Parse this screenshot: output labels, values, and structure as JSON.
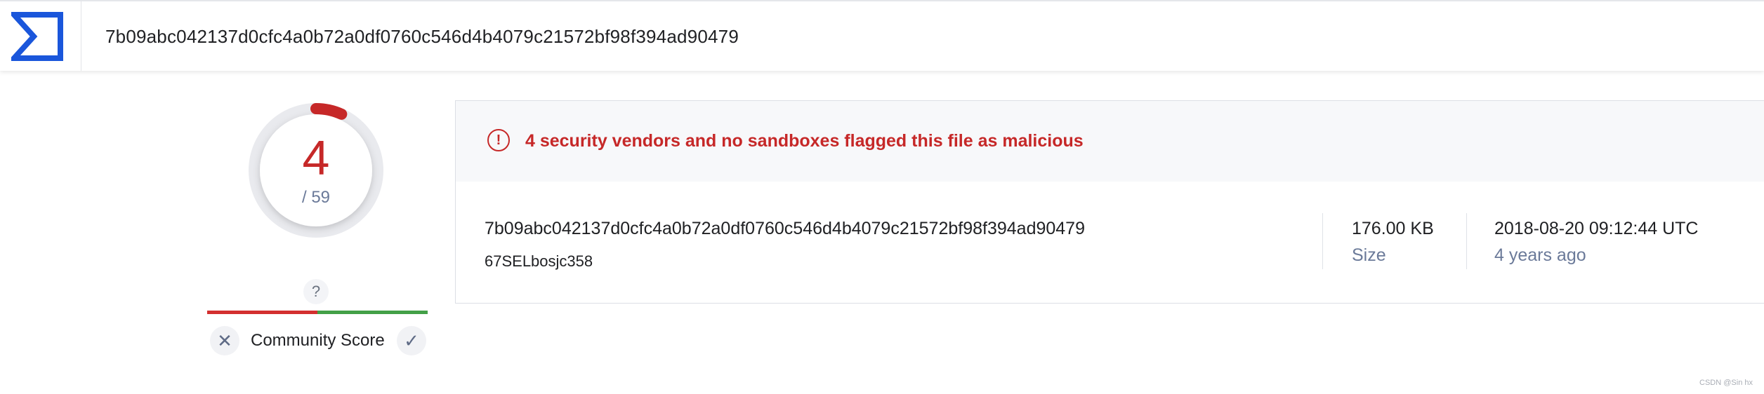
{
  "header": {
    "logo_icon": "sigma-logo-icon",
    "search_value": "7b09abc042137d0cfc4a0b72a0df0760c546d4b4079c21572bf98f394ad90479"
  },
  "detection": {
    "score": "4",
    "total": "/ 59",
    "detected": 4,
    "out_of": 59
  },
  "community": {
    "question_mark": "?",
    "label": "Community Score",
    "downvote_icon": "close-icon",
    "upvote_icon": "check-icon",
    "downvote_glyph": "✕",
    "upvote_glyph": "✓"
  },
  "alert": {
    "icon_glyph": "!",
    "text": "4 security vendors and no sandboxes flagged this file as malicious"
  },
  "file": {
    "hash": "7b09abc042137d0cfc4a0b72a0df0760c546d4b4079c21572bf98f394ad90479",
    "name": "67SELbosjc358",
    "size_value": "176.00 KB",
    "size_label": "Size",
    "date_value": "2018-08-20 09:12:44 UTC",
    "date_relative": "4 years ago"
  },
  "watermark": "CSDN @Sin hx",
  "colors": {
    "malicious": "#c62828",
    "logo": "#1a56db",
    "muted": "#6b7a99",
    "community_bad": "#d32f2f",
    "community_good": "#43a047"
  }
}
